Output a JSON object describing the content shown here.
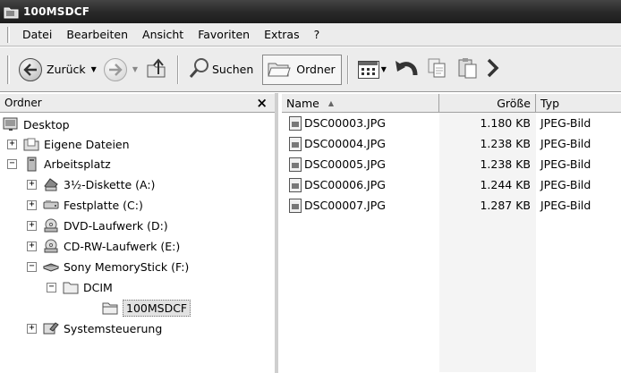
{
  "window": {
    "title": "100MSDCF"
  },
  "menu": [
    "Datei",
    "Bearbeiten",
    "Ansicht",
    "Favoriten",
    "Extras",
    "?"
  ],
  "toolbar": {
    "back_label": "Zurück",
    "search_label": "Suchen",
    "folders_label": "Ordner"
  },
  "folders_pane": {
    "title": "Ordner",
    "close": "×",
    "tree": [
      {
        "label": "Desktop",
        "expander": "",
        "icon": "desktop-icon"
      },
      {
        "label": "Eigene Dateien",
        "expander": "+",
        "icon": "my-documents-icon"
      },
      {
        "label": "Arbeitsplatz",
        "expander": "−",
        "icon": "my-computer-icon"
      },
      {
        "label": "3½-Diskette (A:)",
        "expander": "+",
        "icon": "floppy-drive-icon"
      },
      {
        "label": "Festplatte (C:)",
        "expander": "+",
        "icon": "hard-drive-icon"
      },
      {
        "label": "DVD-Laufwerk (D:)",
        "expander": "+",
        "icon": "dvd-drive-icon"
      },
      {
        "label": "CD-RW-Laufwerk (E:)",
        "expander": "+",
        "icon": "cd-drive-icon"
      },
      {
        "label": "Sony MemoryStick (F:)",
        "expander": "−",
        "icon": "memory-stick-icon"
      },
      {
        "label": "DCIM",
        "expander": "−",
        "icon": "folder-open-icon"
      },
      {
        "label": "100MSDCF",
        "expander": "",
        "icon": "folder-icon"
      },
      {
        "label": "Systemsteuerung",
        "expander": "+",
        "icon": "control-panel-icon"
      }
    ]
  },
  "file_list": {
    "columns": {
      "name": "Name",
      "sort_indicator": "▲",
      "size": "Größe",
      "type": "Typ"
    },
    "rows": [
      {
        "name": "DSC00003.JPG",
        "size": "1.180 KB",
        "type": "JPEG-Bild"
      },
      {
        "name": "DSC00004.JPG",
        "size": "1.238 KB",
        "type": "JPEG-Bild"
      },
      {
        "name": "DSC00005.JPG",
        "size": "1.238 KB",
        "type": "JPEG-Bild"
      },
      {
        "name": "DSC00006.JPG",
        "size": "1.244 KB",
        "type": "JPEG-Bild"
      },
      {
        "name": "DSC00007.JPG",
        "size": "1.287 KB",
        "type": "JPEG-Bild"
      }
    ]
  }
}
